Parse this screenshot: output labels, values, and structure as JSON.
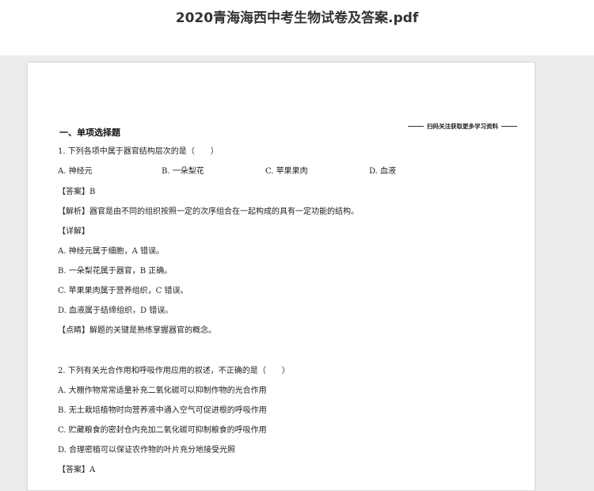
{
  "document": {
    "title": "2020青海海西中考生物试卷及答案.pdf"
  },
  "page": {
    "side_note": "扫码关注获取更多学习资料",
    "section_heading": "一、单项选择题",
    "q1": {
      "stem": "1. 下列各项中属于器官结构层次的是（　　）",
      "options": [
        "A.  神经元",
        "B.  一朵梨花",
        "C.  苹果果肉",
        "D.  血液"
      ],
      "answer": "【答案】B",
      "analysis": "【解析】器官是由不同的组织按照一定的次序组合在一起构成的具有一定功能的结构。",
      "detail_label": "【详解】",
      "details": [
        "A. 神经元属于细胞，A 错误。",
        "B. 一朵梨花属于器官，B 正确。",
        "C. 苹果果肉属于营养组织，C 错误。",
        "D. 血液属于结缔组织，D 错误。"
      ],
      "comment": "【点睛】解题的关键是熟练掌握器官的概念。"
    },
    "q2": {
      "stem": "2. 下列有关光合作用和呼吸作用应用的叙述，不正确的是（　　）",
      "options": [
        "A.  大棚作物常常适量补充二氧化碳可以抑制作物的光合作用",
        "B.  无土栽培植物时向营养液中通入空气可促进根的呼吸作用",
        "C.  贮藏粮食的密封仓内充加二氧化碳可抑制粮食的呼吸作用",
        "D.  合理密植可以保证农作物的叶片充分地接受光照"
      ],
      "answer": "【答案】A"
    }
  }
}
